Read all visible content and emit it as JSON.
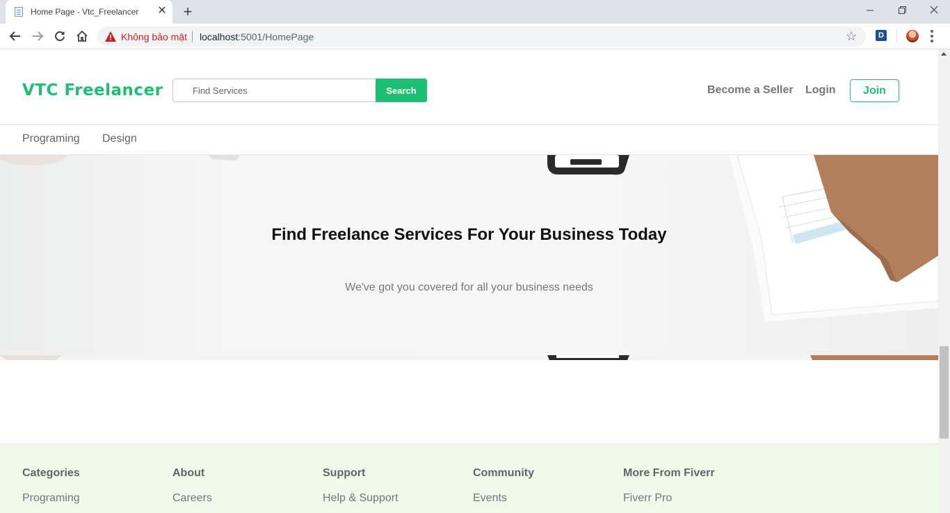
{
  "browser": {
    "tab_title": "Home Page - Vtc_Freelancer",
    "security_label": "Không bảo mật",
    "url_host": "localhost",
    "url_path": ":5001/HomePage",
    "extension_label": "D"
  },
  "header": {
    "logo": "VTC Freelancer",
    "search_placeholder": "Find Services",
    "search_button": "Search",
    "become_seller": "Become a Seller",
    "login": "Login",
    "join": "Join"
  },
  "subnav": {
    "items": [
      "Programing",
      "Design"
    ]
  },
  "hero": {
    "title": "Find Freelance Services For Your Business Today",
    "subtitle": "We've got you covered for all your business needs"
  },
  "footer": {
    "columns": [
      {
        "heading": "Categories",
        "link": "Programing"
      },
      {
        "heading": "About",
        "link": "Careers"
      },
      {
        "heading": "Support",
        "link": "Help & Support"
      },
      {
        "heading": "Community",
        "link": "Events"
      },
      {
        "heading": "More From Fiverr",
        "link": "Fiverr Pro"
      }
    ]
  },
  "colors": {
    "brand": "#1dbf73",
    "footer_bg": "#effaea",
    "insecure": "#c5221f"
  },
  "icons": [
    "page-favicon-icon",
    "close-icon",
    "plus-icon",
    "minimize-icon",
    "maximize-icon",
    "window-close-icon",
    "back-arrow-icon",
    "forward-arrow-icon",
    "reload-icon",
    "home-icon",
    "warning-icon",
    "star-icon",
    "menu-dots-icon"
  ]
}
